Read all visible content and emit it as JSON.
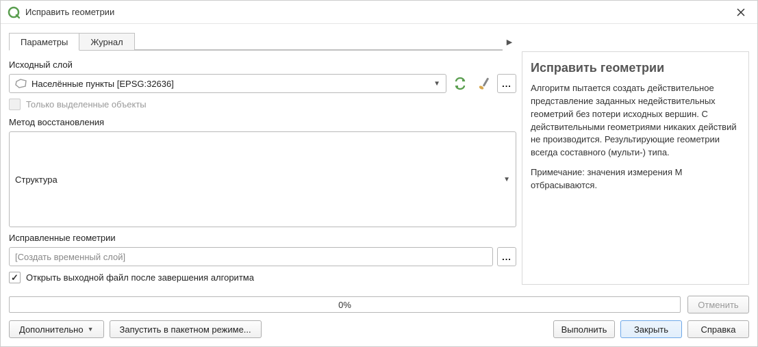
{
  "window": {
    "title": "Исправить геометрии"
  },
  "tabs": {
    "parameters": "Параметры",
    "log": "Журнал"
  },
  "form": {
    "input_layer_label": "Исходный слой",
    "input_layer_value": "Населённые пункты [EPSG:32636]",
    "selected_only_label": "Только выделенные объекты",
    "method_label": "Метод восстановления",
    "method_value": "Структура",
    "output_label": "Исправленные геометрии",
    "output_placeholder": "[Создать временный слой]",
    "open_after_label": "Открыть выходной файл после завершения алгоритма",
    "open_after_check": "✓"
  },
  "help": {
    "title": "Исправить геометрии",
    "paragraph1": "Алгоритм пытается создать действительное представление заданных недействительных геометрий без потери исходных вершин. С действительными геометриями никаких действий не производится. Результирующие геометрии всегда составного (мульти-) типа.",
    "paragraph2": "Примечание: значения измерения M отбрасываются."
  },
  "progress": {
    "text": "0%"
  },
  "buttons": {
    "cancel": "Отменить",
    "advanced": "Дополнительно",
    "batch": "Запустить в пакетном режиме...",
    "run": "Выполнить",
    "close": "Закрыть",
    "help": "Справка"
  }
}
